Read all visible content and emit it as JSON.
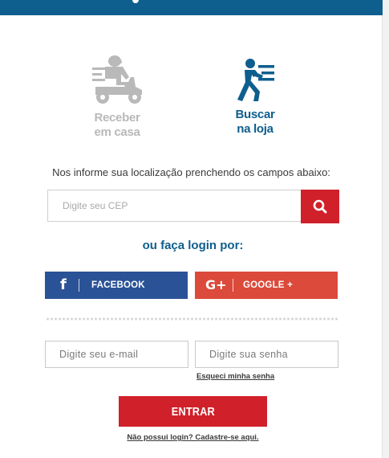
{
  "delivery": {
    "home_line1": "Receber",
    "home_line2": "em casa",
    "store_line1": "Buscar",
    "store_line2": "na loja"
  },
  "location": {
    "info_text": "Nos informe sua localização prenchendo os campos abaixo:",
    "cep_placeholder": "Digite seu CEP",
    "search_icon": "search-icon"
  },
  "login": {
    "title": "ou faça login por:",
    "facebook_label": "FACEBOOK",
    "facebook_icon": "f",
    "google_label": "GOOGLE +",
    "google_icon": "G+",
    "email_placeholder": "Digite seu e-mail",
    "password_placeholder": "Digite sua senha",
    "forgot_link": "Esqueci minha senha",
    "submit_label": "ENTRAR",
    "signup_link": "Não possui login? Cadastre-se aqui."
  },
  "colors": {
    "brand_blue": "#0e5e8e",
    "brand_red": "#d0202a",
    "facebook_blue": "#2a5297",
    "google_red": "#db4a3a",
    "inactive_gray": "#b9b9b9"
  }
}
